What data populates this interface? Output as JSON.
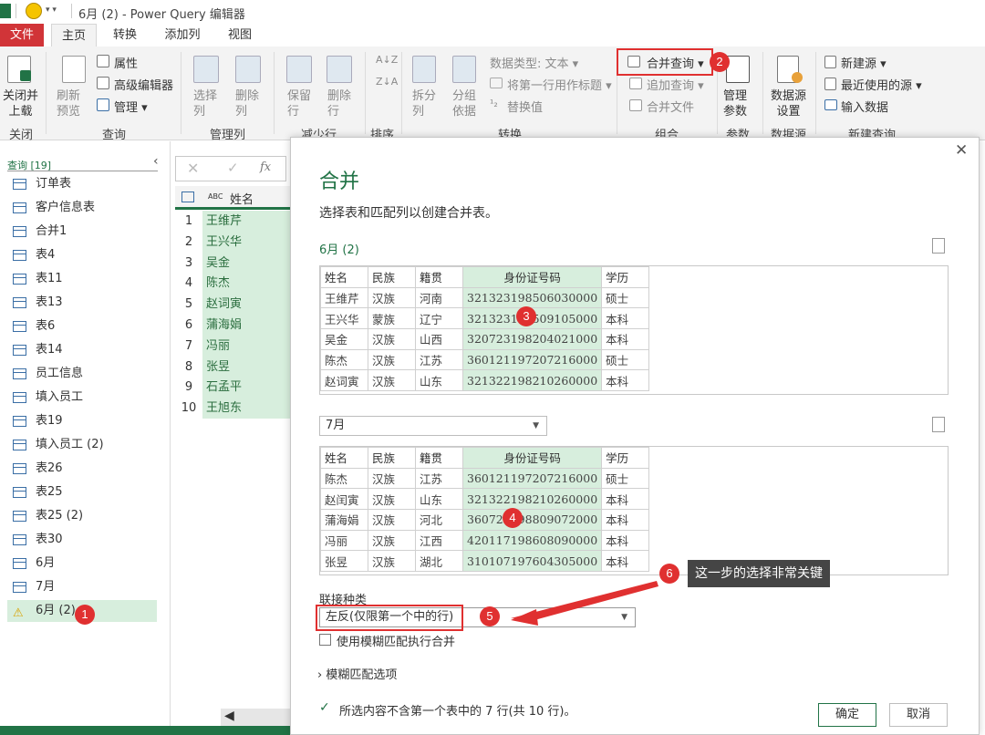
{
  "app": {
    "title": "6月 (2) - Power Query 编辑器"
  },
  "tabs": [
    "文件",
    "主页",
    "转换",
    "添加列",
    "视图"
  ],
  "ribbon": {
    "close_load": "关闭并\n上载",
    "close_group": "关闭",
    "refresh_preview": "刷新\n预览",
    "properties": "属性",
    "advanced_editor": "高级编辑器",
    "manage": "管理",
    "query_group": "查询",
    "choose_columns": "选择\n列",
    "remove_columns": "删除\n列",
    "manage_columns_group": "管理列",
    "keep_rows": "保留\n行",
    "remove_rows": "删除\n行",
    "reduce_rows_group": "减少行",
    "sort_group": "排序",
    "split_column": "拆分\n列",
    "group_by": "分组\n依据",
    "data_type": "数据类型: 文本",
    "first_row_header": "将第一行用作标题",
    "replace_values": "替换值",
    "transform_group": "转换",
    "merge_queries": "合并查询",
    "append_queries": "追加查询",
    "merge_files": "合并文件",
    "combine_group": "组合",
    "manage_params": "管理\n参数",
    "params_group": "参数",
    "data_source_settings": "数据源\n设置",
    "data_source_group": "数据源",
    "new_source": "新建源",
    "recent_sources": "最近使用的源",
    "enter_data": "输入数据",
    "new_query_group": "新建查询"
  },
  "left_pane": {
    "header": "查询 [19]",
    "items": [
      "订单表",
      "客户信息表",
      "合并1",
      "表4",
      "表11",
      "表13",
      "表6",
      "表14",
      "员工信息",
      "填入员工",
      "表19",
      "填入员工 (2)",
      "表26",
      "表25",
      "表25 (2)",
      "表30",
      "6月",
      "7月",
      "6月 (2)"
    ]
  },
  "formula_bar": {
    "fx": "fx"
  },
  "grid": {
    "column": "姓名",
    "type_icon": "ABC",
    "rows": [
      "王维芹",
      "王兴华",
      "吴金",
      "陈杰",
      "赵词寅",
      "蒲海娟",
      "冯丽",
      "张昱",
      "石孟平",
      "王旭东"
    ]
  },
  "dialog": {
    "title": "合并",
    "subtitle": "选择表和匹配列以创建合并表。",
    "table1_name": "6月 (2)",
    "columns": [
      "姓名",
      "民族",
      "籍贯",
      "身份证号码",
      "学历"
    ],
    "table1_rows": [
      [
        "王维芹",
        "汉族",
        "河南",
        "321323198506030000",
        "硕士"
      ],
      [
        "王兴华",
        "蒙族",
        "辽宁",
        "321323198509105000",
        "本科"
      ],
      [
        "吴金",
        "汉族",
        "山西",
        "320723198204021000",
        "本科"
      ],
      [
        "陈杰",
        "汉族",
        "江苏",
        "360121197207216000",
        "硕士"
      ],
      [
        "赵词寅",
        "汉族",
        "山东",
        "321322198210260000",
        "本科"
      ]
    ],
    "table2_select": "7月",
    "table2_rows": [
      [
        "陈杰",
        "汉族",
        "江苏",
        "360121197207216000",
        "硕士"
      ],
      [
        "赵闰寅",
        "汉族",
        "山东",
        "321322198210260000",
        "本科"
      ],
      [
        "蒲海娟",
        "汉族",
        "河北",
        "360723198809072000",
        "本科"
      ],
      [
        "冯丽",
        "汉族",
        "江西",
        "420117198608090000",
        "本科"
      ],
      [
        "张昱",
        "汉族",
        "湖北",
        "310107197604305000",
        "本科"
      ]
    ],
    "join_kind_label": "联接种类",
    "join_kind_value": "左反(仅限第一个中的行)",
    "fuzzy_checkbox": "使用模糊匹配执行合并",
    "fuzzy_options": "模糊匹配选项",
    "status": "所选内容不含第一个表中的 7 行(共 10 行)。",
    "ok": "确定",
    "cancel": "取消",
    "close": "✕"
  },
  "annotations": {
    "badges": [
      "1",
      "2",
      "3",
      "4",
      "5",
      "6"
    ],
    "tooltip": "这一步的选择非常关键"
  },
  "colors": {
    "accent": "#217346",
    "badge": "#e03030",
    "highlight": "#d7eedd",
    "file_tab": "#d13438"
  }
}
